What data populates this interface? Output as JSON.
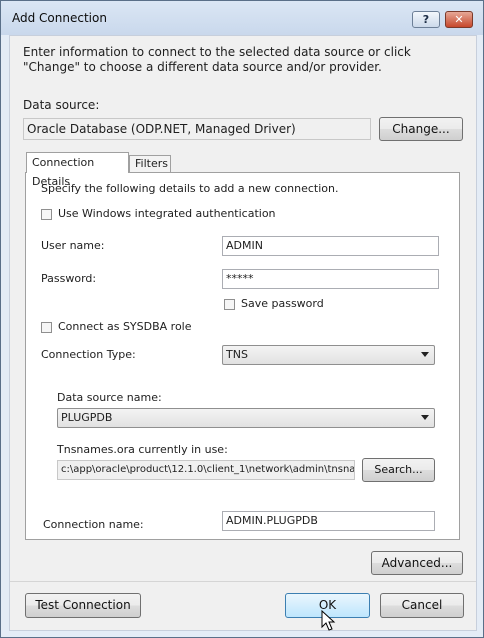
{
  "window": {
    "title": "Add Connection",
    "help_button": "?",
    "close_button": "✕"
  },
  "intro_text": "Enter information to connect to the selected data source or click \"Change\" to choose a different data source and/or provider.",
  "data_source": {
    "label": "Data source:",
    "value": "Oracle Database (ODP.NET, Managed Driver)",
    "change_button": "Change..."
  },
  "tabs": [
    {
      "label": "Connection Details",
      "active": true
    },
    {
      "label": "Filters",
      "active": false
    }
  ],
  "details": {
    "instructions": "Specify the following details to add a new connection.",
    "windows_auth_label": "Use Windows integrated authentication",
    "windows_auth_checked": false,
    "user_name_label": "User name:",
    "user_name_value": "ADMIN",
    "password_label": "Password:",
    "password_value": "*****",
    "save_password_label": "Save password",
    "save_password_checked": false,
    "sysdba_label": "Connect as SYSDBA role",
    "sysdba_checked": false,
    "connection_type_label": "Connection Type:",
    "connection_type_value": "TNS",
    "data_source_name_label": "Data source name:",
    "data_source_name_value": "PLUGPDB",
    "tnsnames_label": "Tnsnames.ora currently in use:",
    "tnsnames_value": "c:\\app\\oracle\\product\\12.1.0\\client_1\\network\\admin\\tnsnam",
    "search_button": "Search...",
    "connection_name_label": "Connection name:",
    "connection_name_value": "ADMIN.PLUGPDB"
  },
  "buttons": {
    "advanced": "Advanced...",
    "test_connection": "Test Connection",
    "ok": "OK",
    "cancel": "Cancel"
  },
  "colors": {
    "title_bar": "#c9d8ec",
    "close_button": "#c7472b",
    "focused_button": "#3c7fb1"
  }
}
